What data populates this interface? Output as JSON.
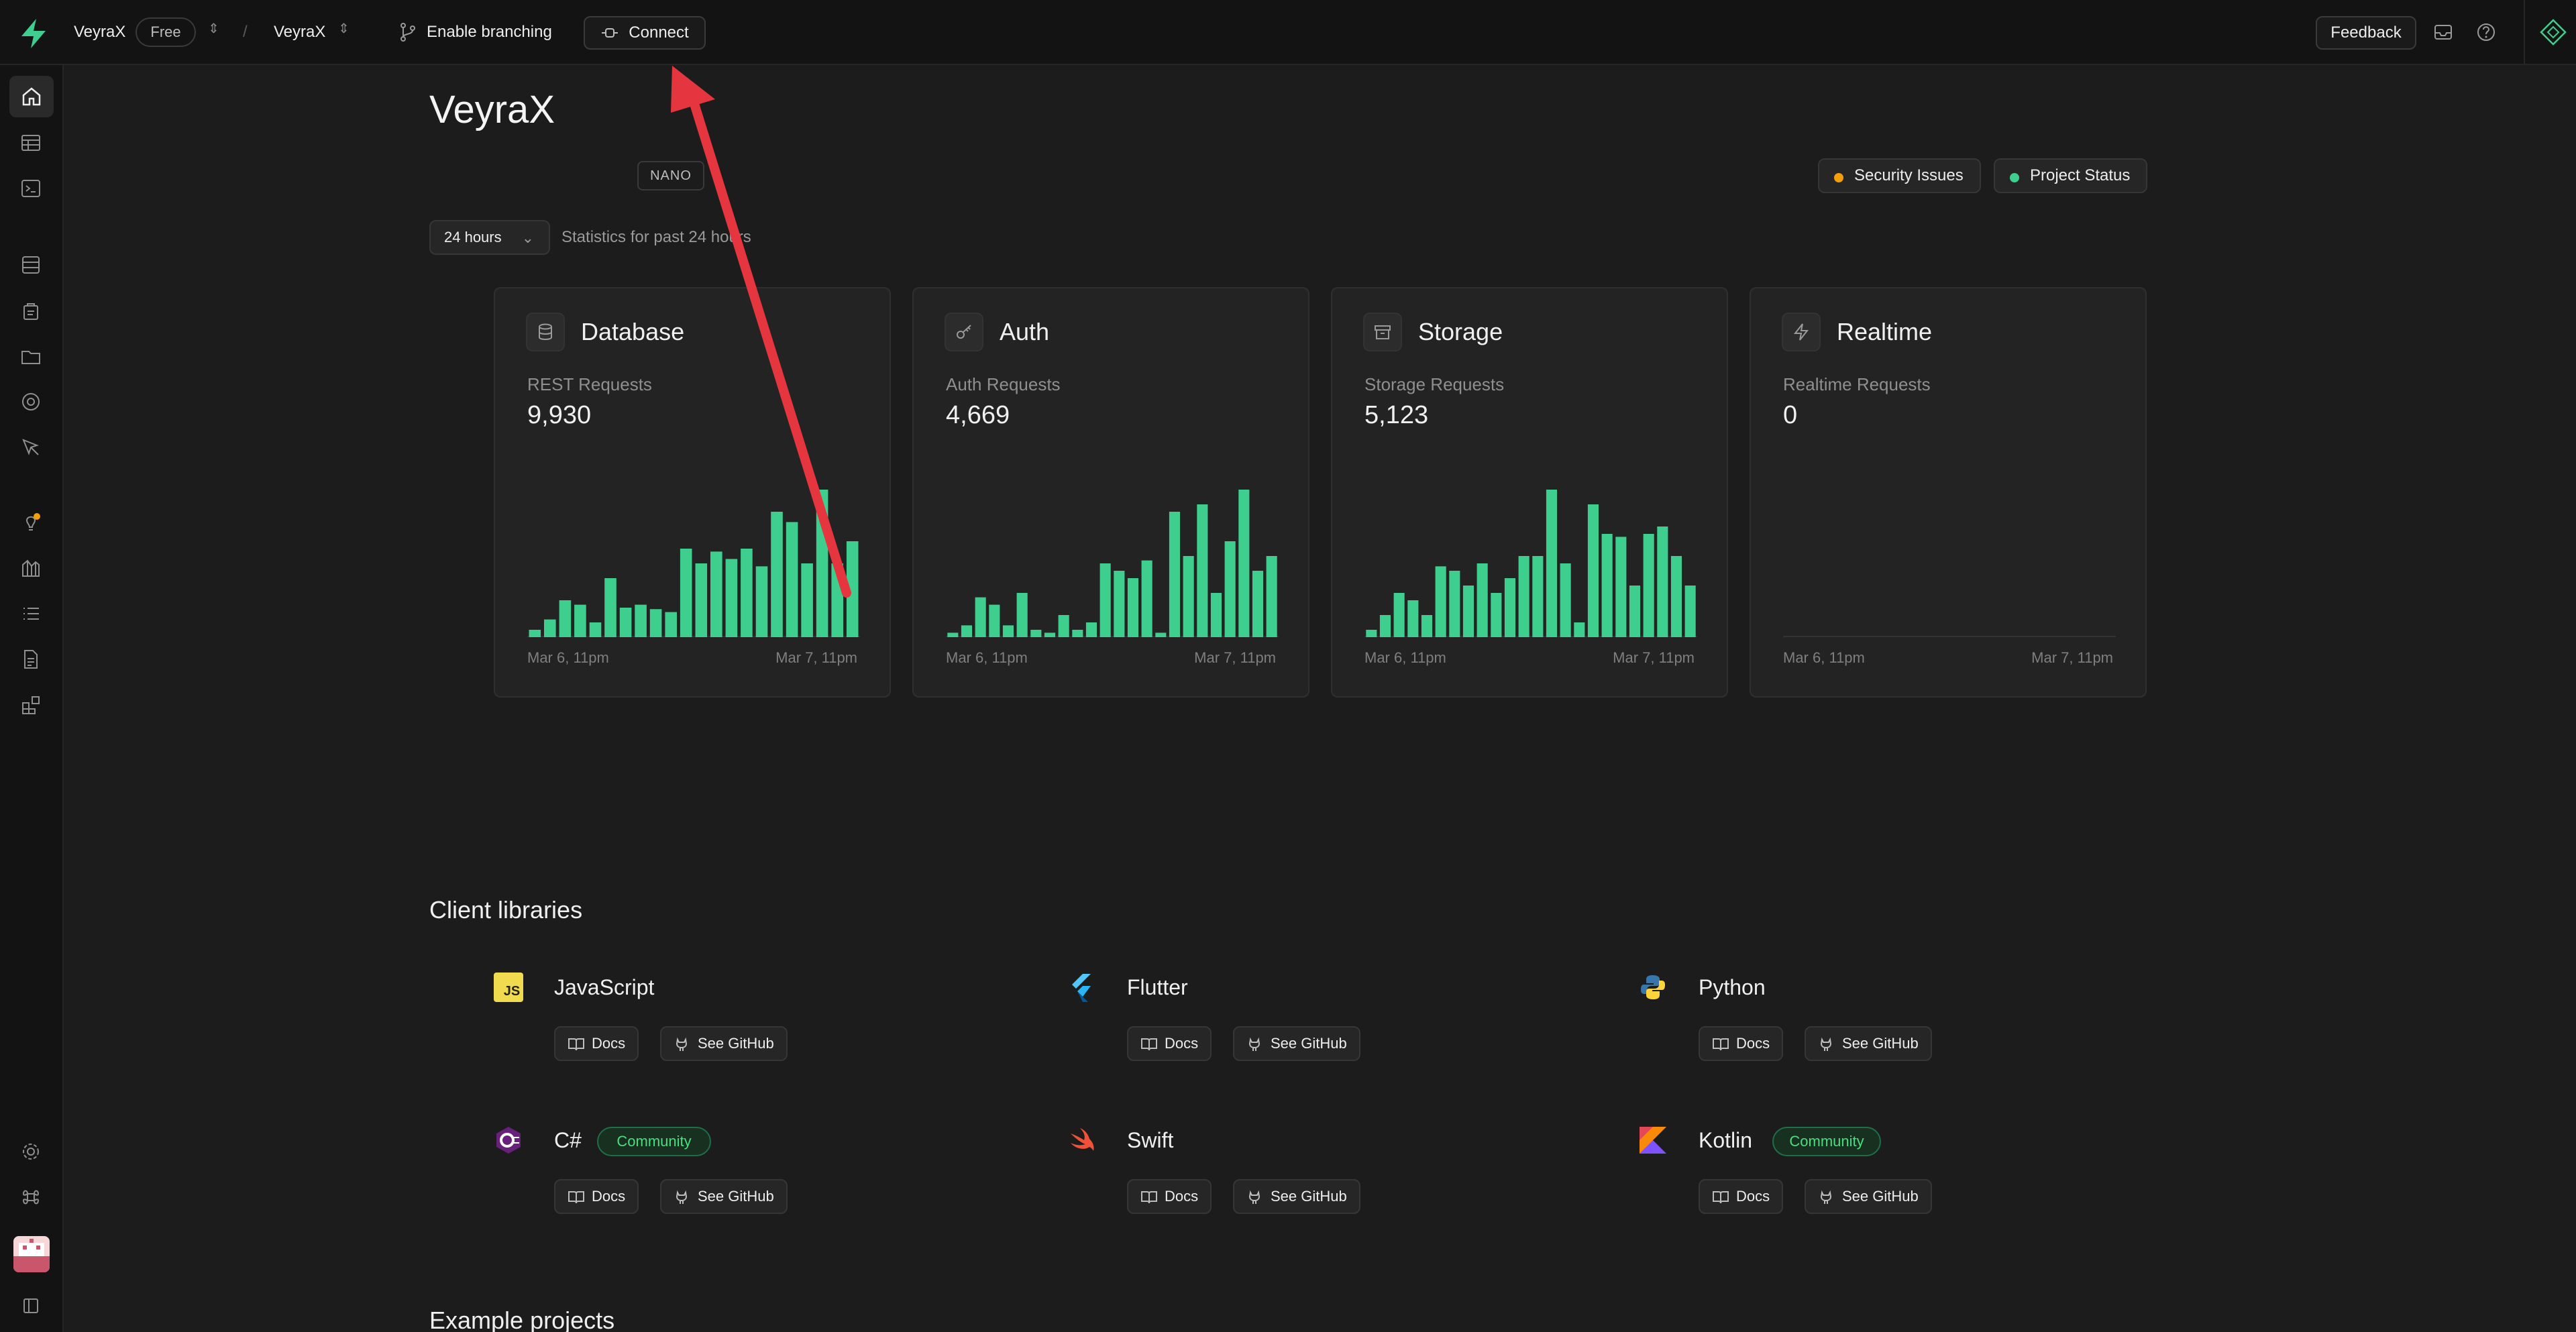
{
  "topbar": {
    "org_name": "VeyraX",
    "plan": "Free",
    "project_name": "VeyraX",
    "branching_label": "Enable branching",
    "connect_label": "Connect",
    "feedback_label": "Feedback"
  },
  "sidebar": {
    "items": [
      "home-icon",
      "table-editor-icon",
      "sql-editor-icon",
      "database-icon",
      "auth-icon",
      "storage-icon",
      "realtime-icon",
      "edge-functions-icon",
      "advisors-icon",
      "reports-icon",
      "logs-icon",
      "api-docs-icon",
      "integrations-icon",
      "settings-icon",
      "command-icon",
      "avatar",
      "collapse-icon"
    ]
  },
  "header": {
    "title": "VeyraX",
    "tier": "NANO",
    "security_label": "Security Issues",
    "status_label": "Project Status",
    "security_color": "#f59e0b",
    "status_color": "#3ecf8e"
  },
  "stats": {
    "range_label": "24 hours",
    "range_note": "Statistics for past 24 hours"
  },
  "cards": [
    {
      "title": "Database",
      "sub": "REST Requests",
      "value": "9,930",
      "from": "Mar 6, 11pm",
      "to": "Mar 7, 11pm"
    },
    {
      "title": "Auth",
      "sub": "Auth Requests",
      "value": "4,669",
      "from": "Mar 6, 11pm",
      "to": "Mar 7, 11pm"
    },
    {
      "title": "Storage",
      "sub": "Storage Requests",
      "value": "5,123",
      "from": "Mar 6, 11pm",
      "to": "Mar 7, 11pm"
    },
    {
      "title": "Realtime",
      "sub": "Realtime Requests",
      "value": "0",
      "from": "Mar 6, 11pm",
      "to": "Mar 7, 11pm"
    }
  ],
  "chart_data": [
    {
      "type": "bar",
      "title": "Database",
      "series": [
        {
          "values": [
            5,
            12,
            25,
            22,
            10,
            40,
            20,
            22,
            19,
            17,
            60,
            50,
            58,
            53,
            60,
            48,
            85,
            78,
            50,
            100,
            50,
            65
          ]
        }
      ],
      "ylim": [
        0,
        100
      ]
    },
    {
      "type": "bar",
      "title": "Auth",
      "series": [
        {
          "values": [
            3,
            8,
            27,
            22,
            8,
            30,
            5,
            3,
            15,
            5,
            10,
            50,
            45,
            40,
            52,
            3,
            85,
            55,
            90,
            30,
            65,
            100,
            45,
            55
          ]
        }
      ],
      "ylim": [
        0,
        100
      ]
    },
    {
      "type": "bar",
      "title": "Storage",
      "series": [
        {
          "values": [
            5,
            15,
            30,
            25,
            15,
            48,
            45,
            35,
            50,
            30,
            40,
            55,
            55,
            100,
            50,
            10,
            90,
            70,
            68,
            35,
            70,
            75,
            55,
            35
          ]
        }
      ],
      "ylim": [
        0,
        100
      ]
    },
    {
      "type": "bar",
      "title": "Realtime",
      "series": [
        {
          "values": []
        }
      ],
      "ylim": [
        0,
        1
      ]
    }
  ],
  "client_libraries": {
    "title": "Client libraries",
    "docs_label": "Docs",
    "github_label": "See GitHub",
    "community_label": "Community",
    "items": [
      {
        "name": "JavaScript"
      },
      {
        "name": "Flutter"
      },
      {
        "name": "Python"
      },
      {
        "name": "C#"
      },
      {
        "name": "Swift"
      },
      {
        "name": "Kotlin"
      }
    ]
  },
  "example_projects": {
    "title": "Example projects"
  },
  "colors": {
    "accent": "#3ecf8e",
    "bar": "#3ecf8e",
    "arrow": "#e5353f"
  }
}
